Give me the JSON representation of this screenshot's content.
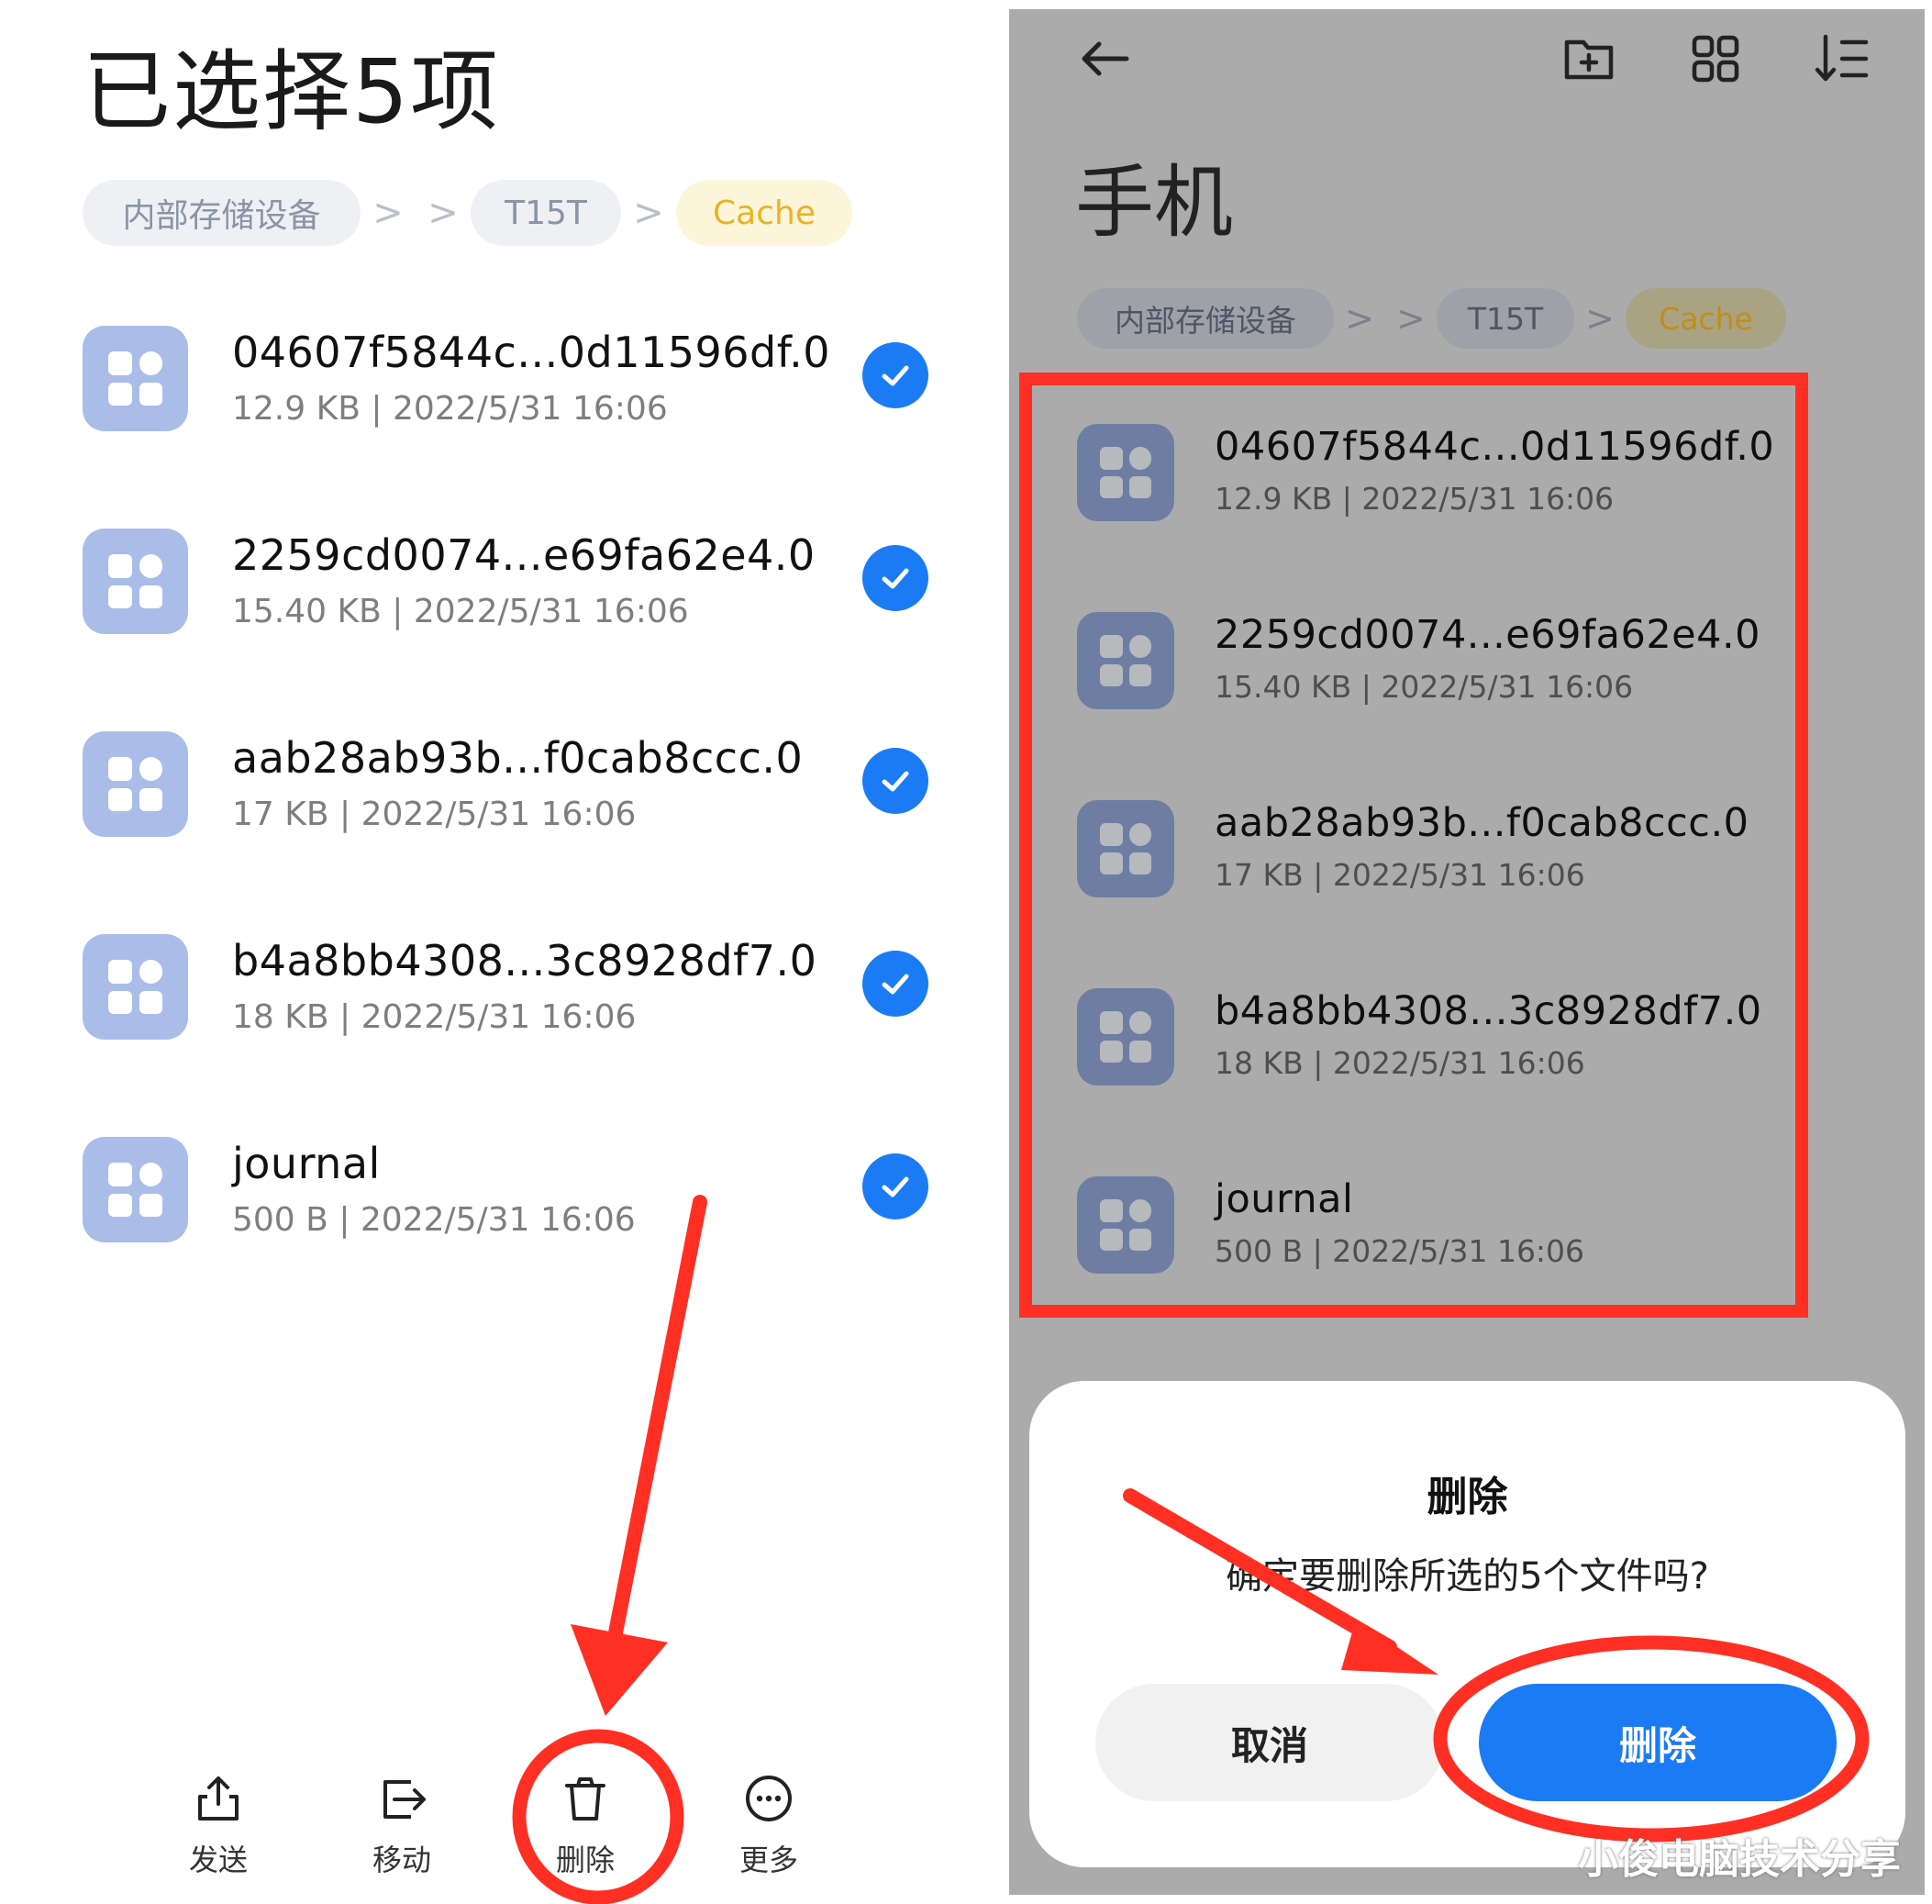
{
  "left_screen": {
    "title": "已选择5项",
    "breadcrumb": {
      "device": "内部存储设备",
      "separator": ">",
      "folder": "T15T",
      "current": "Cache"
    },
    "files": [
      {
        "name": "04607f5844c...0d11596df.0",
        "size": "12.9 KB",
        "divider": "|",
        "date": "2022/5/31 16:06",
        "selected": true
      },
      {
        "name": "2259cd0074...e69fa62e4.0",
        "size": "15.40 KB",
        "divider": "|",
        "date": "2022/5/31 16:06",
        "selected": true
      },
      {
        "name": "aab28ab93b...f0cab8ccc.0",
        "size": "17 KB",
        "divider": "|",
        "date": "2022/5/31 16:06",
        "selected": true
      },
      {
        "name": "b4a8bb4308...3c8928df7.0",
        "size": "18 KB",
        "divider": "|",
        "date": "2022/5/31 16:06",
        "selected": true
      },
      {
        "name": "journal",
        "size": "500 B",
        "divider": "|",
        "date": "2022/5/31 16:06",
        "selected": true
      }
    ],
    "bottom_bar": [
      {
        "label": "发送",
        "icon": "share-icon"
      },
      {
        "label": "移动",
        "icon": "move-icon"
      },
      {
        "label": "删除",
        "icon": "trash-icon"
      },
      {
        "label": "更多",
        "icon": "more-icon"
      }
    ]
  },
  "right_screen": {
    "toolbar_icons": [
      "back-arrow-icon",
      "new-folder-icon",
      "grid-view-icon",
      "sort-icon"
    ],
    "title": "手机",
    "breadcrumb": {
      "device": "内部存储设备",
      "separator": ">",
      "folder": "T15T",
      "current": "Cache"
    },
    "files": [
      {
        "name": "04607f5844c...0d11596df.0",
        "size": "12.9 KB",
        "divider": "|",
        "date": "2022/5/31 16:06"
      },
      {
        "name": "2259cd0074...e69fa62e4.0",
        "size": "15.40 KB",
        "divider": "|",
        "date": "2022/5/31 16:06"
      },
      {
        "name": "aab28ab93b...f0cab8ccc.0",
        "size": "17 KB",
        "divider": "|",
        "date": "2022/5/31 16:06"
      },
      {
        "name": "b4a8bb4308...3c8928df7.0",
        "size": "18 KB",
        "divider": "|",
        "date": "2022/5/31 16:06"
      },
      {
        "name": "journal",
        "size": "500 B",
        "divider": "|",
        "date": "2022/5/31 16:06"
      }
    ],
    "dialog": {
      "title": "删除",
      "message": "确定要删除所选的5个文件吗?",
      "cancel_label": "取消",
      "confirm_label": "删除"
    }
  },
  "watermark": "小俊电脑技术分享",
  "colors": {
    "accent_blue": "#1b7bf5",
    "annotation_red": "#ff2f24",
    "file_icon": "#a9bde8",
    "cache_chip_text": "#e8b325"
  }
}
